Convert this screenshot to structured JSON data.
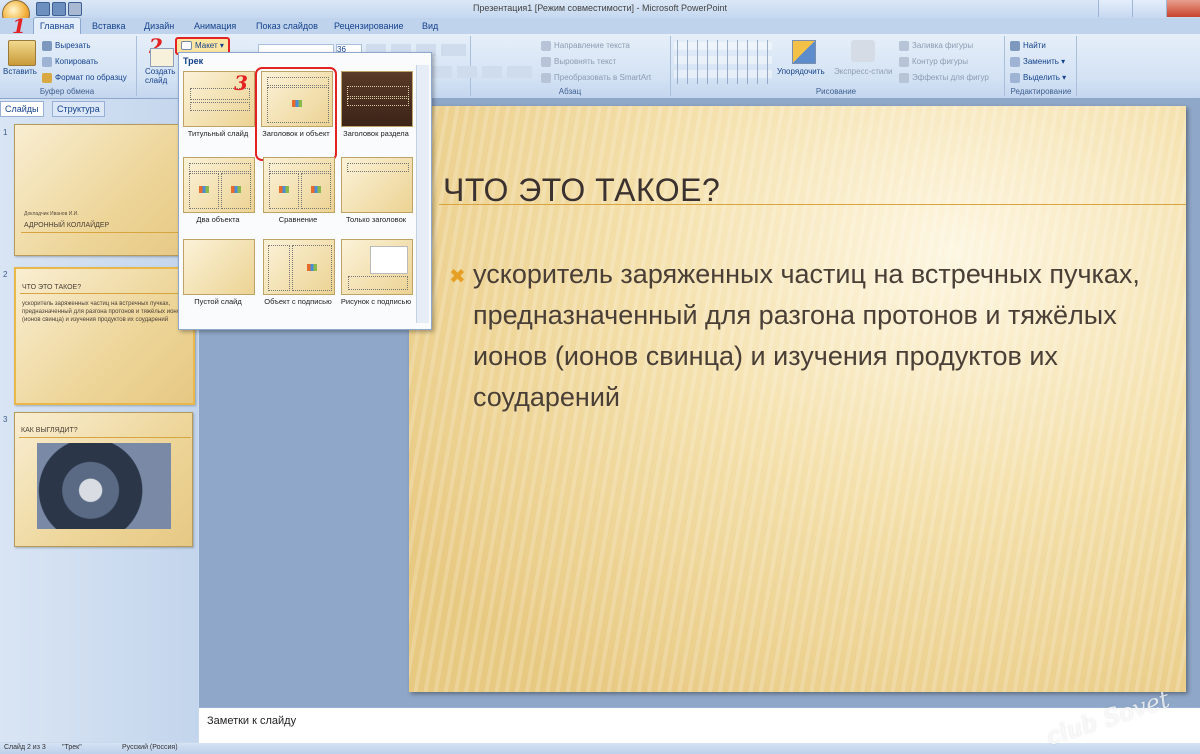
{
  "window": {
    "title": "Презентация1 [Режим совместимости] - Microsoft PowerPoint"
  },
  "tabs": [
    "Главная",
    "Вставка",
    "Дизайн",
    "Анимация",
    "Показ слайдов",
    "Рецензирование",
    "Вид"
  ],
  "ribbon": {
    "clipboard": {
      "paste": "Вставить",
      "cut": "Вырезать",
      "copy": "Копировать",
      "format_painter": "Формат по образцу",
      "group_label": "Буфер обмена"
    },
    "slides": {
      "new_slide_line1": "Создать",
      "new_slide_line2": "слайд",
      "layout": "Макет"
    },
    "font": {
      "font_size": "36"
    },
    "paragraph": {
      "text_direction": "Направление текста",
      "align_text": "Выровнять текст",
      "smartart": "Преобразовать в SmartArt",
      "group_label": "Абзац"
    },
    "drawing": {
      "arrange": "Упорядочить",
      "quick_styles": "Экспресс-стили",
      "shape_fill": "Заливка фигуры",
      "shape_outline": "Контур фигуры",
      "shape_effects": "Эффекты для фигур",
      "group_label": "Рисование"
    },
    "editing": {
      "find": "Найти",
      "replace": "Заменить",
      "select": "Выделить",
      "group_label": "Редактирование"
    }
  },
  "annotations": {
    "step1": "1",
    "step2": "2",
    "step3": "3"
  },
  "layout_gallery": {
    "header": "Трек",
    "items": [
      {
        "label": "Титульный слайд"
      },
      {
        "label": "Заголовок и объект"
      },
      {
        "label": "Заголовок раздела"
      },
      {
        "label": "Два объекта"
      },
      {
        "label": "Сравнение"
      },
      {
        "label": "Только заголовок"
      },
      {
        "label": "Пустой слайд"
      },
      {
        "label": "Объект с подписью"
      },
      {
        "label": "Рисунок с подписью"
      }
    ]
  },
  "pane_tabs": {
    "slides": "Слайды",
    "outline": "Структура"
  },
  "thumbnails": [
    {
      "num": "1",
      "subtitle": "Докладчик Иванов И.И.",
      "title": "АДРОННЫЙ КОЛЛАЙДЕР"
    },
    {
      "num": "2",
      "title": "ЧТО ЭТО ТАКОЕ?",
      "body": "ускоритель заряженных частиц на встречных пучках, предназначенный для разгона протонов и тяжёлых ионов (ионов свинца) и изучения продуктов их соударений"
    },
    {
      "num": "3",
      "title": "КАК ВЫГЛЯДИТ?"
    }
  ],
  "slide": {
    "title": "ЧТО ЭТО ТАКОЕ?",
    "body": "ускоритель заряженных частиц на встречных пучках, предназначенный для разгона протонов и тяжёлых ионов (ионов свинца) и изучения продуктов их соударений"
  },
  "notes": {
    "placeholder": "Заметки к слайду"
  },
  "status": {
    "slide_count": "Слайд 2 из 3",
    "theme": "\"Трек\"",
    "language": "Русский (Россия)"
  },
  "watermark": "club Sovet",
  "colors": {
    "highlight": "#e32222",
    "accent": "#d7a440",
    "ribbon": "#d3e2f4"
  }
}
